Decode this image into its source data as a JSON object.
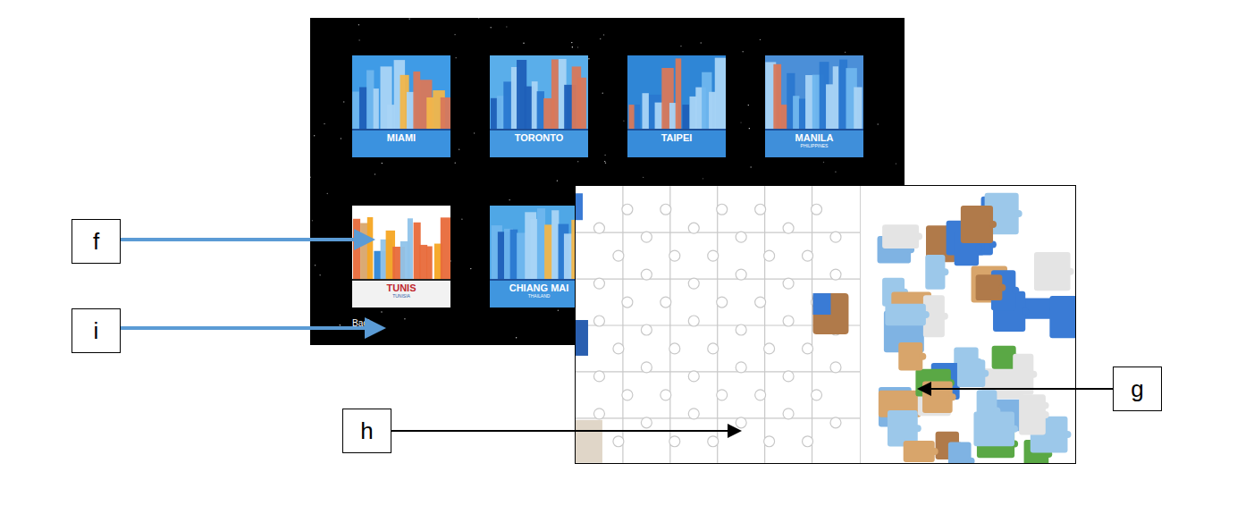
{
  "level_select": {
    "levels": [
      {
        "name": "MIAMI",
        "subtitle": "",
        "color": "#3f9be6",
        "text_color": "#ffffff"
      },
      {
        "name": "TORONTO",
        "subtitle": "",
        "color": "#5aaeea",
        "text_color": "#ffffff"
      },
      {
        "name": "TAIPEI",
        "subtitle": "",
        "color": "#2f86d6",
        "text_color": "#ffffff"
      },
      {
        "name": "MANILA",
        "subtitle": "PHILIPPINES",
        "color": "#4b8fd8",
        "text_color": "#ffffff"
      },
      {
        "name": "TUNIS",
        "subtitle": "TUNISIA",
        "color": "#ffffff",
        "text_color": "#c0272d"
      },
      {
        "name": "CHIANG MAI",
        "subtitle": "THAILAND",
        "color": "#4fa7e6",
        "text_color": "#ffffff"
      }
    ],
    "back_button": "Back"
  },
  "callouts": [
    {
      "label": "f",
      "color": "#5b9bd5"
    },
    {
      "label": "i",
      "color": "#5b9bd5"
    },
    {
      "label": "h",
      "color": "#000000"
    },
    {
      "label": "g",
      "color": "#000000"
    }
  ]
}
